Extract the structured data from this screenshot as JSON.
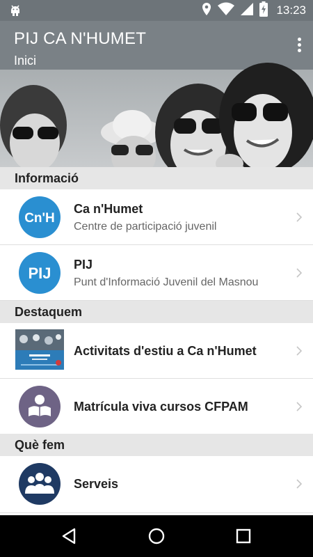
{
  "status_bar": {
    "time": "13:23",
    "icons": [
      "android-icon",
      "location-icon",
      "wifi-icon",
      "signal-icon",
      "battery-icon"
    ]
  },
  "app_bar": {
    "title": "PIJ CA N'HUMET",
    "subtitle": "Inici",
    "menu_icon": "overflow-menu-icon"
  },
  "sections": {
    "informacio": {
      "header": "Informació",
      "items": [
        {
          "icon_text": "Cn'H",
          "title": "Ca n'Humet",
          "description": "Centre de participació juvenil",
          "icon_color": "#2a8fd1"
        },
        {
          "icon_text": "PIJ",
          "title": "PIJ",
          "description": "Punt d'Informació Juvenil del Masnou",
          "icon_color": "#2a8fd1"
        }
      ]
    },
    "destaquem": {
      "header": "Destaquem",
      "items": [
        {
          "title": "Activitats d'estiu a Ca n'Humet",
          "icon": "activity-thumbnail"
        },
        {
          "title": "Matrícula viva cursos CFPAM",
          "icon": "reader-icon",
          "icon_color": "#6e6385"
        }
      ]
    },
    "que_fem": {
      "header": "Què fem",
      "items": [
        {
          "title": "Serveis",
          "icon": "group-icon",
          "icon_color": "#1f3a63"
        }
      ]
    }
  },
  "nav": {
    "back": "back-icon",
    "home": "home-icon",
    "recents": "recents-icon"
  },
  "colors": {
    "status_bar": "#6d7479",
    "section_bg": "#e6e6e6",
    "accent_blue": "#2a8fd1"
  }
}
